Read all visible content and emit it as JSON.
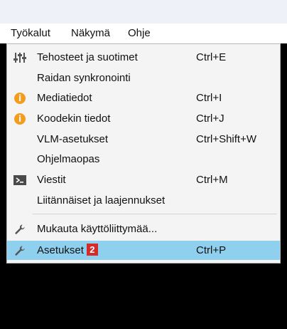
{
  "menubar": {
    "items": [
      {
        "label": "Työkalut"
      },
      {
        "label": "Näkymä"
      },
      {
        "label": "Ohje"
      }
    ]
  },
  "menu": {
    "items": [
      {
        "label": "Tehosteet ja suotimet",
        "shortcut": "Ctrl+E",
        "icon": "equalizer-icon"
      },
      {
        "label": "Raidan synkronointi",
        "shortcut": "",
        "icon": ""
      },
      {
        "label": "Mediatiedot",
        "shortcut": "Ctrl+I",
        "icon": "info-icon"
      },
      {
        "label": "Koodekin tiedot",
        "shortcut": "Ctrl+J",
        "icon": "info-icon"
      },
      {
        "label": "VLM-asetukset",
        "shortcut": "Ctrl+Shift+W",
        "icon": ""
      },
      {
        "label": "Ohjelmaopas",
        "shortcut": "",
        "icon": ""
      },
      {
        "label": "Viestit",
        "shortcut": "Ctrl+M",
        "icon": "terminal-icon"
      },
      {
        "label": "Liitännäiset ja laajennukset",
        "shortcut": "",
        "icon": ""
      },
      {
        "label": "Mukauta käyttöliittymää...",
        "shortcut": "",
        "icon": "wrench-icon"
      },
      {
        "label": "Asetukset",
        "shortcut": "Ctrl+P",
        "icon": "wrench-icon",
        "badge": "2",
        "highlighted": true
      }
    ]
  },
  "colors": {
    "highlight": "#8fd0ef",
    "badge": "#d52a2a",
    "info_icon": "#f39c1d"
  }
}
